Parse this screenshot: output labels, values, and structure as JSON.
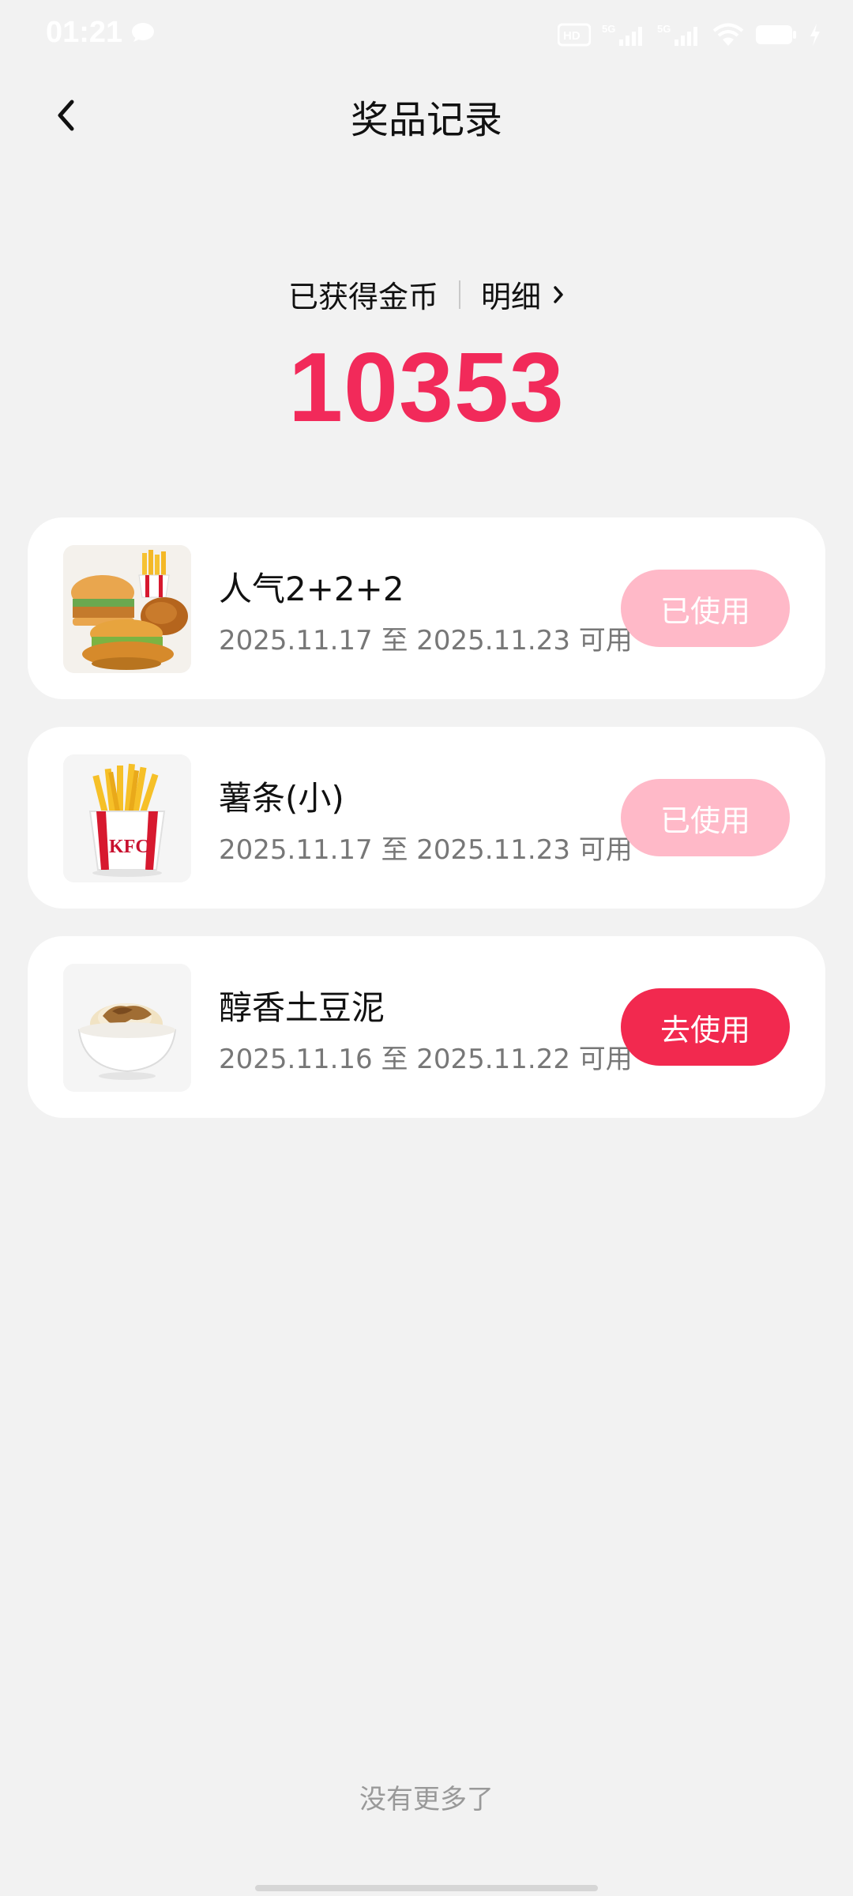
{
  "status_bar": {
    "time": "01:21",
    "icons": [
      "chat-bubble-icon",
      "hd-icon",
      "5g-signal-icon",
      "5g-signal-icon",
      "wifi-icon",
      "battery-icon",
      "charging-icon"
    ]
  },
  "header": {
    "title": "奖品记录",
    "back_icon": "chevron-left-icon"
  },
  "coins": {
    "label": "已获得金币",
    "detail_label": "明细",
    "value": "10353",
    "accent_color": "#f22a5a"
  },
  "prizes": [
    {
      "name": "人气2+2+2",
      "date": "2025.11.17 至 2025.11.23 可用",
      "button_label": "已使用",
      "status": "used",
      "thumb_icon": "burger-meal-image"
    },
    {
      "name": "薯条(小)",
      "date": "2025.11.17 至 2025.11.23 可用",
      "button_label": "已使用",
      "status": "used",
      "thumb_icon": "fries-image"
    },
    {
      "name": "醇香土豆泥",
      "date": "2025.11.16 至 2025.11.22 可用",
      "button_label": "去使用",
      "status": "active",
      "thumb_icon": "mashed-potato-image"
    }
  ],
  "footer": {
    "no_more": "没有更多了"
  },
  "colors": {
    "used_button": "#ffb9c8",
    "active_button": "#f2294f",
    "background": "#f2f2f2"
  }
}
